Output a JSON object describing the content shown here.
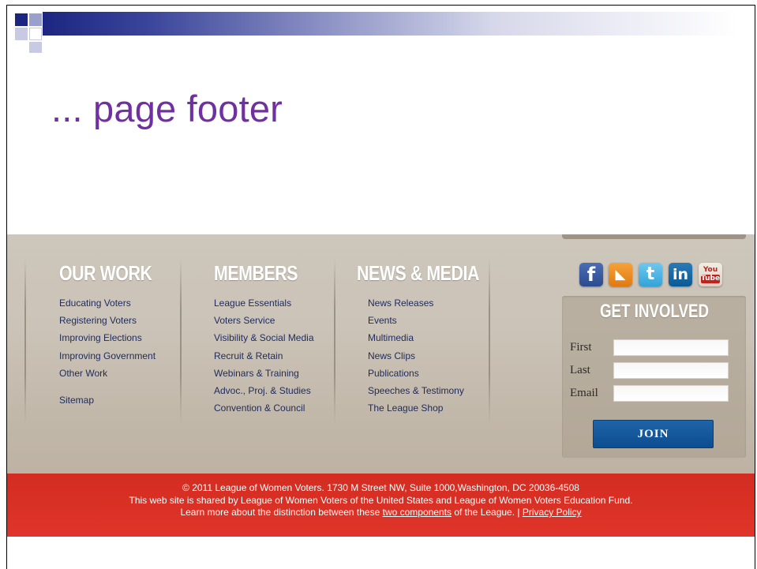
{
  "slide": {
    "title": "... page footer"
  },
  "footer": {
    "columns": [
      {
        "heading": "OUR WORK",
        "items": [
          "Educating Voters",
          "Registering Voters",
          "Improving Elections",
          "Improving Government",
          "Other Work"
        ],
        "extra": "Sitemap"
      },
      {
        "heading": "MEMBERS",
        "items": [
          "League Essentials",
          "Voters Service",
          "Visibility & Social Media",
          "Recruit & Retain",
          "Webinars & Training",
          "Advoc., Proj. & Studies",
          "Convention & Council"
        ]
      },
      {
        "heading": "NEWS & MEDIA",
        "items": [
          "News Releases",
          "Events",
          "Multimedia",
          "News Clips",
          "Publications",
          "Speeches & Testimony",
          "The League Shop"
        ]
      }
    ],
    "social": {
      "facebook": "f",
      "rss": "◣",
      "twitter": "t",
      "linkedin": "in",
      "youtube_top": "You",
      "youtube_bottom": "Tube"
    },
    "get_involved": {
      "title": "GET INVOLVED",
      "first_label": "First",
      "last_label": "Last",
      "email_label": "Email",
      "join_label": "JOIN"
    },
    "legal": {
      "line1": "© 2011 League of Women Voters. 1730 M Street NW, Suite 1000,Washington, DC 20036-4508",
      "line2": "This web site is shared by League of Women Voters of the United States and League of Women Voters Education Fund.",
      "line3_pre": "Learn more about the distinction between these ",
      "line3_link": "two components",
      "line3_mid": " of the League. | ",
      "privacy_link": "Privacy Policy"
    }
  },
  "colors": {
    "title": "#7030a0",
    "footer_bg": "#c8bfb3",
    "link_text": "#1e2b5c",
    "red_bar": "#d9302a",
    "join_button": "#155b9e"
  }
}
